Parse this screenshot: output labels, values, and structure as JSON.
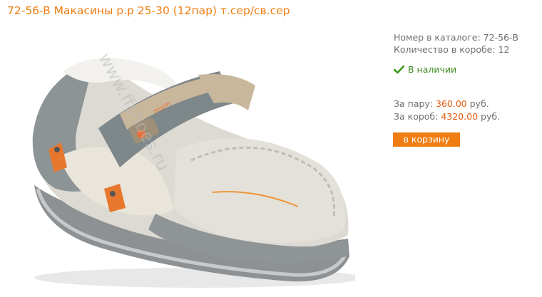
{
  "product": {
    "title": "72-56-B Макасины р.р 25-30 (12пар) т.сер/св.сер",
    "catalog_label": "Номер в каталоге:",
    "catalog_number": "72-56-B",
    "box_qty_label": "Количество в коробе:",
    "box_qty": "12",
    "stock_status": "В наличии",
    "price_pair_label": "За пару:",
    "price_pair": "360.00",
    "price_box_label": "За короб:",
    "price_box": "4320.00",
    "currency": "руб.",
    "add_to_cart_label": "в корзину"
  },
  "photo": {
    "watermark": "www.ffshoes.ru",
    "badge_text": "mxm"
  },
  "colors": {
    "accent": "#f07d11",
    "title": "#ee7d12",
    "in_stock": "#3d8a1e",
    "price": "#e35b10",
    "text_muted": "#6f6f6f"
  },
  "icons": {
    "stock": "checkmark-icon"
  }
}
